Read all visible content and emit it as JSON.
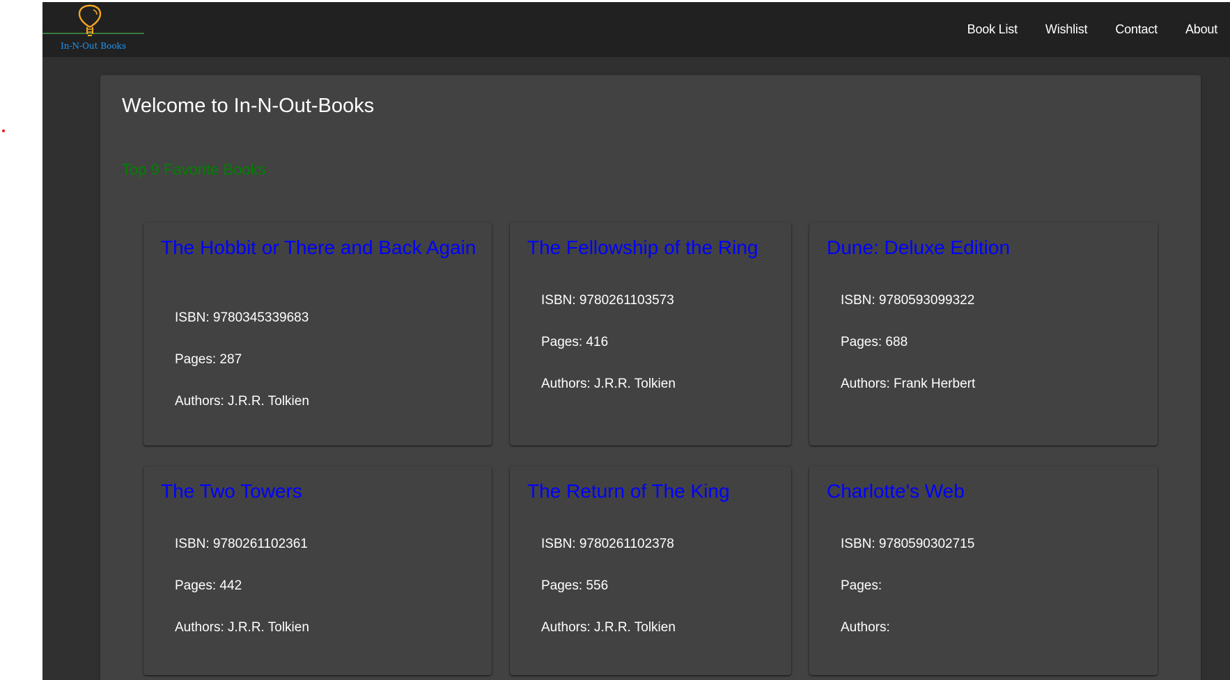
{
  "colors": {
    "page_bg": "#303030",
    "nav_bg": "#212121",
    "card_bg": "#424242",
    "title_link": "#0000ff",
    "section_title": "#008000",
    "logo_bulb": "#f5a623",
    "logo_text": "#2196f3",
    "logo_line": "#4caf50"
  },
  "logo": {
    "icon": "lightbulb-icon",
    "text": "In-N-Out Books"
  },
  "nav": {
    "items": [
      {
        "label": "Book List"
      },
      {
        "label": "Wishlist"
      },
      {
        "label": "Contact"
      },
      {
        "label": "About"
      }
    ]
  },
  "main": {
    "title": "Welcome to In-N-Out-Books",
    "section_title": "Top 9 Favorite Books"
  },
  "books": [
    {
      "title": "The Hobbit or There and Back Again",
      "isbn": "ISBN: 9780345339683",
      "pages": "Pages: 287",
      "authors": "Authors: J.R.R. Tolkien"
    },
    {
      "title": "The Fellowship of the Ring",
      "isbn": "ISBN: 9780261103573",
      "pages": "Pages: 416",
      "authors": "Authors: J.R.R. Tolkien"
    },
    {
      "title": "Dune: Deluxe Edition",
      "isbn": "ISBN: 9780593099322",
      "pages": "Pages: 688",
      "authors": "Authors: Frank Herbert"
    },
    {
      "title": "The Two Towers",
      "isbn": "ISBN: 9780261102361",
      "pages": "Pages: 442",
      "authors": "Authors: J.R.R. Tolkien"
    },
    {
      "title": "The Return of The King",
      "isbn": "ISBN: 9780261102378",
      "pages": "Pages: 556",
      "authors": "Authors: J.R.R. Tolkien"
    },
    {
      "title": "Charlotte's Web",
      "isbn": "ISBN: 9780590302715",
      "pages": "Pages:",
      "authors": "Authors:"
    }
  ]
}
